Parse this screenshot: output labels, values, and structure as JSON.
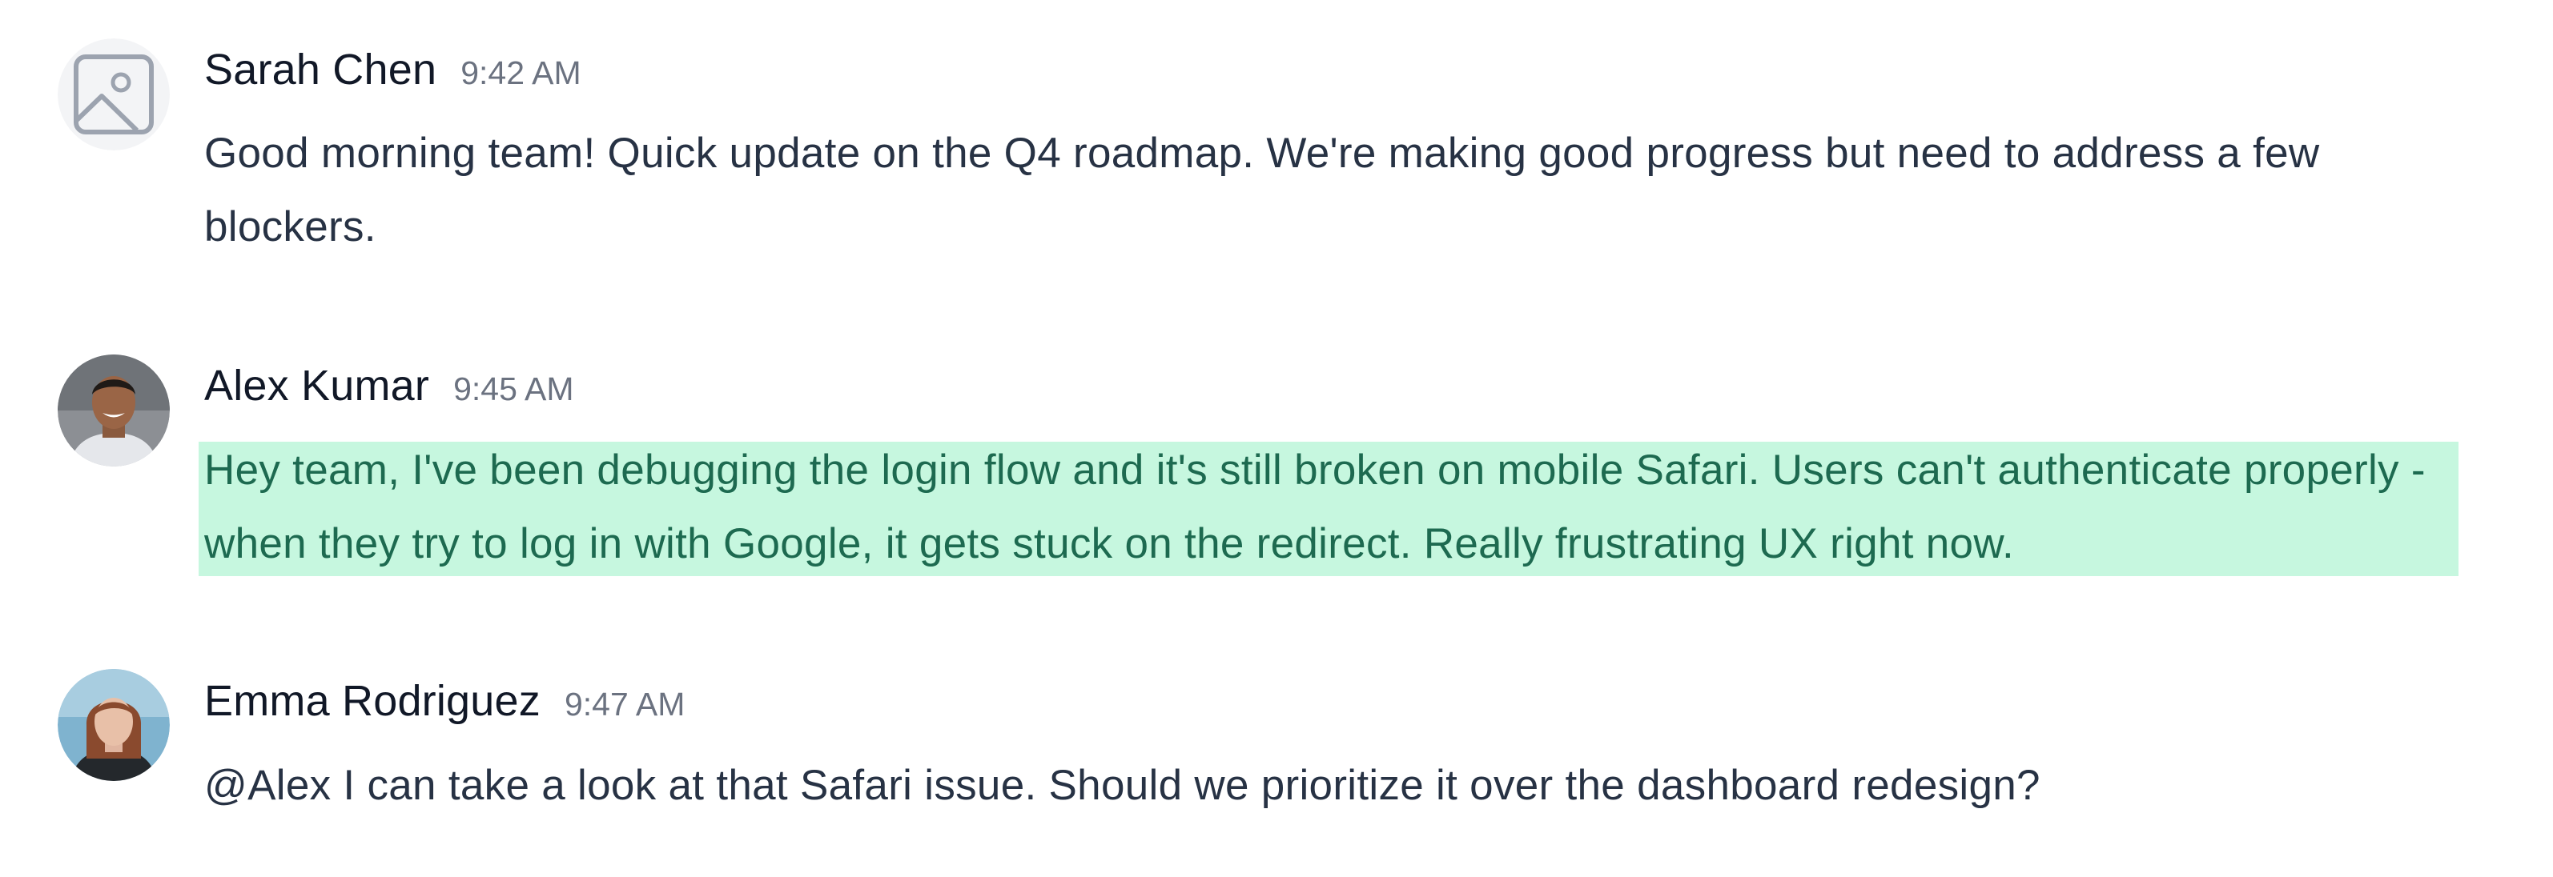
{
  "messages": [
    {
      "author": "Sarah Chen",
      "time": "9:42 AM",
      "text": "Good morning team! Quick update on the Q4 roadmap. We're making good progress but need to address a few blockers.",
      "avatar": "image-placeholder-icon",
      "highlighted": false
    },
    {
      "author": "Alex Kumar",
      "time": "9:45 AM",
      "text": "Hey team, I've been debugging the login flow and it's still broken on mobile Safari. Users can't authenticate properly - when they try to log in with Google, it gets stuck on the redirect. Really frustrating UX right now.",
      "avatar": "user-photo-avatar",
      "highlighted": true
    },
    {
      "author": "Emma Rodriguez",
      "time": "9:47 AM",
      "text": "@Alex I can take a look at that Safari issue. Should we prioritize it over the dashboard redesign?",
      "avatar": "user-photo-avatar",
      "highlighted": false
    }
  ],
  "colors": {
    "highlight_bg": "#c6f7df",
    "highlight_text": "#1d6a50",
    "author": "#111827",
    "timestamp": "#6b7280",
    "body_text": "#273244"
  }
}
